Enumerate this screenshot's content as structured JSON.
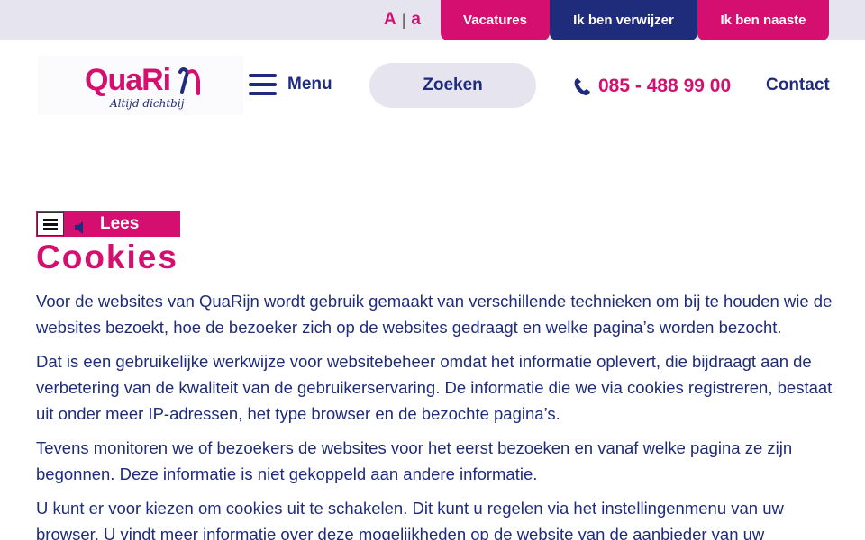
{
  "topbar": {
    "font_large": "A",
    "font_separator": "|",
    "font_small": "a",
    "vacatures": "Vacatures",
    "verwijzer": "Ik ben verwijzer",
    "naaste": "Ik ben naaste"
  },
  "header": {
    "logo_name": "QuaRijn",
    "logo_tagline": "Altijd dichtbij",
    "menu_label": "Menu",
    "search_label": "Zoeken",
    "phone_number": "085 - 488 99 00",
    "contact_label": "Contact"
  },
  "readspeaker": {
    "label": "Lees"
  },
  "page": {
    "title": "Cookies",
    "paragraphs": [
      "Voor de websites van QuaRijn wordt gebruik gemaakt van verschillende technieken om bij te houden wie de websites bezoekt, hoe de bezoeker zich op de websites gedraagt en welke pagina’s worden bezocht.",
      "Dat is een gebruikelijke werkwijze voor websitebeheer omdat het informatie oplevert, die bijdraagt aan de verbetering van de kwaliteit van de gebruikerservaring. De informatie die we via cookies registreren, bestaat uit onder meer IP-adressen, het type browser en de bezochte pagina’s.",
      "Tevens monitoren we of bezoekers de websites voor het eerst bezoeken en vanaf welke pagina ze zijn begonnen. Deze informatie is niet gekoppeld aan andere informatie.",
      "U kunt er voor kiezen om cookies uit te schakelen. Dit kunt u regelen via het instellingenmenu van uw browser. U vindt meer informatie over deze mogelijkheden op de website van de aanbieder van uw"
    ]
  },
  "colors": {
    "brand_pink": "#d50f6f",
    "brand_navy": "#1f2b7b",
    "topbar_bg": "#e6e4ee"
  },
  "icons": {
    "menu": "hamburger-icon",
    "phone": "phone-icon",
    "readspeaker_menu": "list-icon",
    "readspeaker_play": "speaker-icon"
  }
}
